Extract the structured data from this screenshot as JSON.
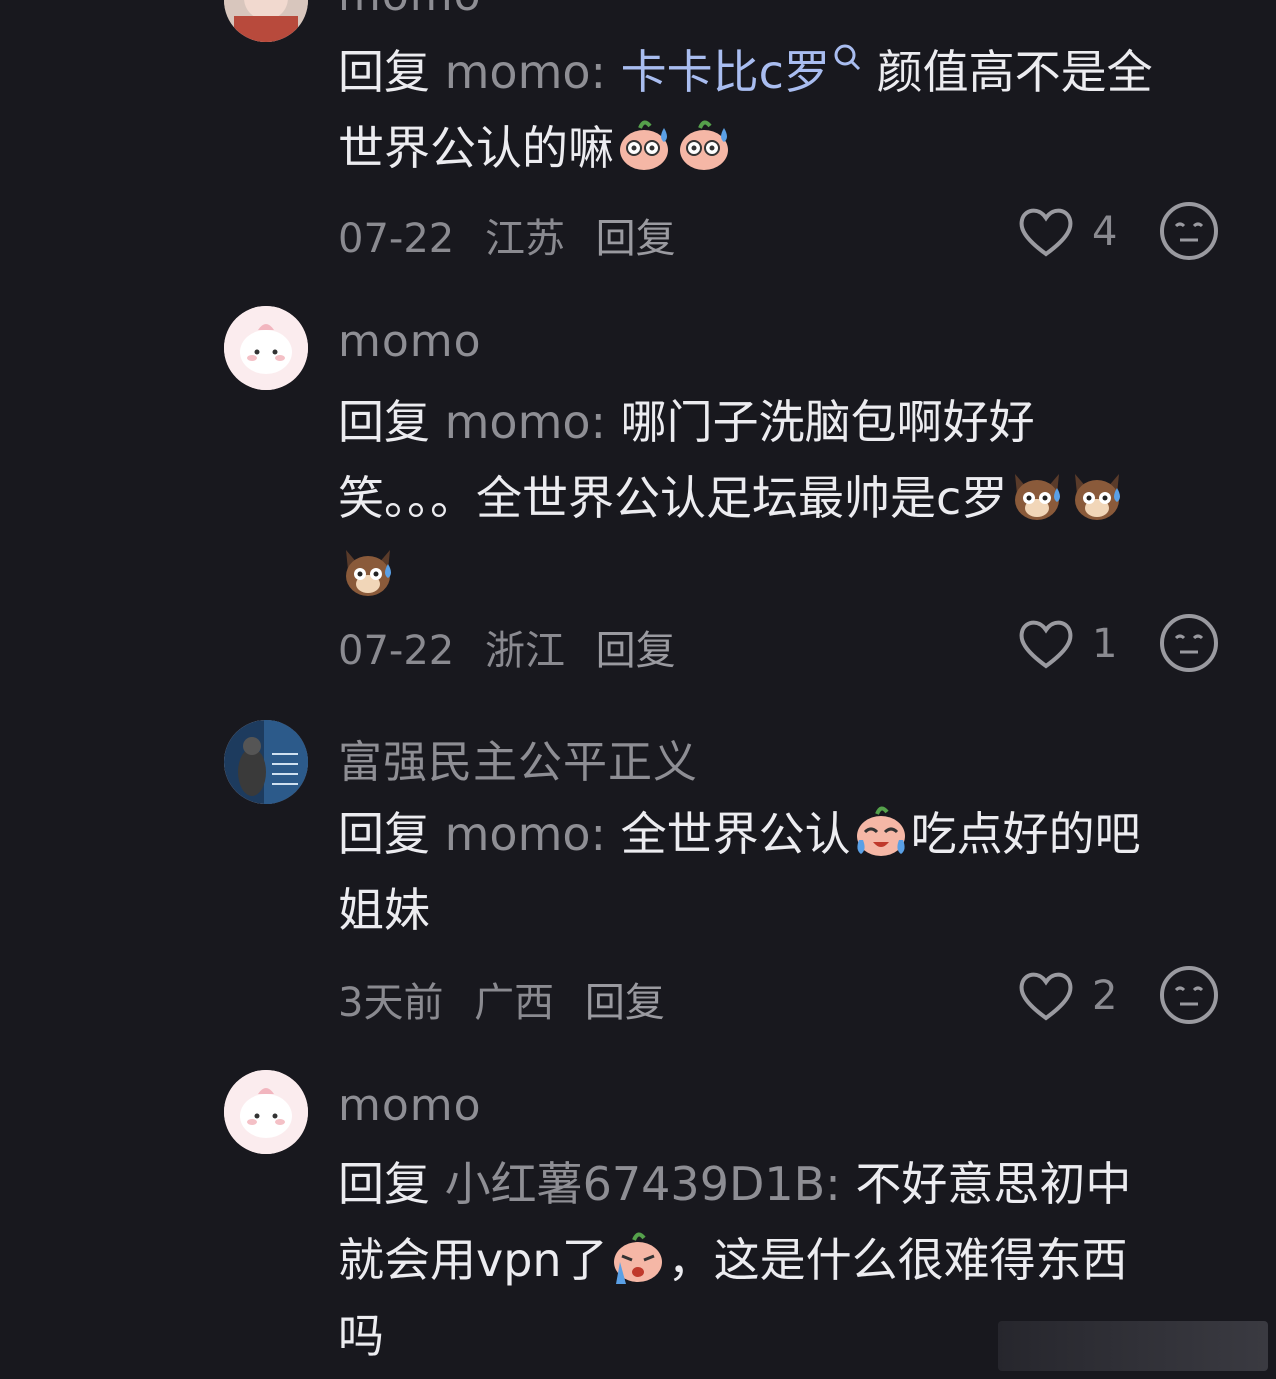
{
  "theme": {
    "background": "#18181e",
    "link_color": "#a9bdf0",
    "muted": "#8e8e94"
  },
  "comments": [
    {
      "username": "momo",
      "reply_prefix": "回复",
      "reply_target": "momo:",
      "segments": {
        "link": "卡卡比c罗",
        "text": "颜值高不是全世界公认的嘛"
      },
      "emojis": [
        "sweating-peach-emoji",
        "sweating-peach-emoji"
      ],
      "date": "07-22",
      "location": "江苏",
      "reply_label": "回复",
      "likes": "4"
    },
    {
      "username": "momo",
      "reply_prefix": "回复",
      "reply_target": "momo:",
      "segments": {
        "text": "哪门子洗脑包啊好好笑。。。全世界公认足坛最帅是c罗"
      },
      "emojis": [
        "sweating-dog-emoji",
        "sweating-dog-emoji",
        "sweating-dog-emoji"
      ],
      "date": "07-22",
      "location": "浙江",
      "reply_label": "回复",
      "likes": "1"
    },
    {
      "username": "富强民主公平正义",
      "reply_prefix": "回复",
      "reply_target": "momo:",
      "segments": {
        "text_a": "全世界公认",
        "text_b": "吃点好的吧姐妹"
      },
      "emojis": [
        "laughing-crying-emoji"
      ],
      "date": "3天前",
      "location": "广西",
      "reply_label": "回复",
      "likes": "2"
    },
    {
      "username": "momo",
      "reply_prefix": "回复",
      "reply_target": "小红薯67439D1B:",
      "segments": {
        "text_a": "不好意思初中就会用vpn了",
        "text_b": "，这是什么很难得东西吗"
      },
      "emojis": [
        "crying-emoji"
      ]
    }
  ]
}
